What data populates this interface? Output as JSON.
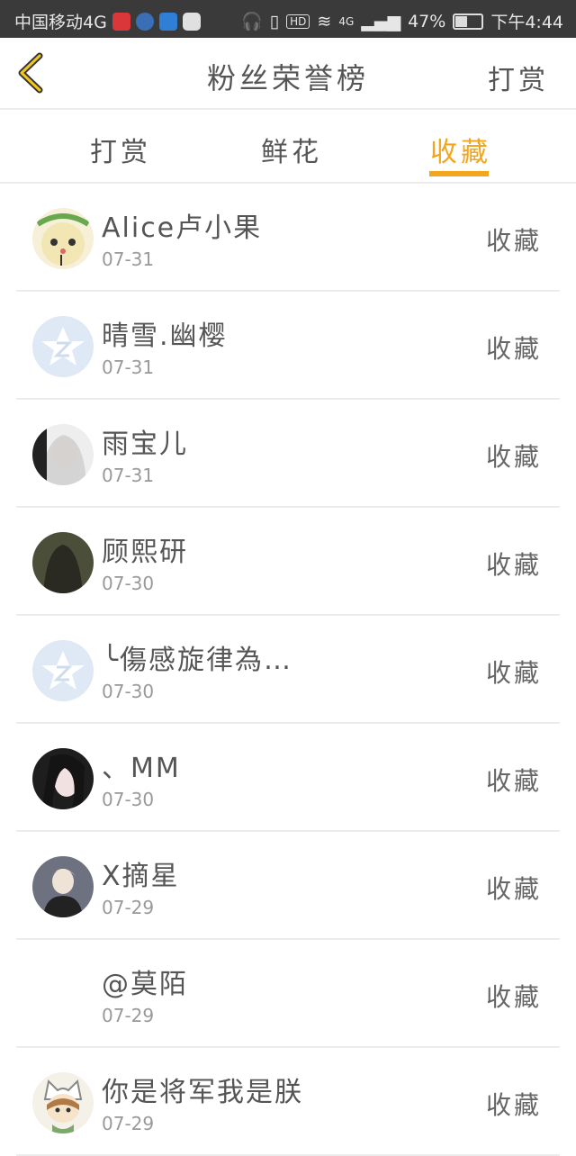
{
  "status_bar": {
    "carrier": "中国移动4G",
    "network": "4G",
    "battery": "47%",
    "time": "下午4:44",
    "icons": [
      "mic-icon",
      "phone-app-icon",
      "shield-icon",
      "app-icon",
      "headphones-icon",
      "vibrate-icon",
      "hd-icon",
      "wifi-icon",
      "signal-icon",
      "battery-icon"
    ],
    "battery_level": 0.47
  },
  "header": {
    "title": "粉丝荣誉榜",
    "action": "打赏",
    "back_icon": "chevron-left-icon"
  },
  "tabs": [
    {
      "label": "打赏"
    },
    {
      "label": "鲜花"
    },
    {
      "label": "收藏",
      "active": true
    }
  ],
  "colors": {
    "accent": "#f3a51b",
    "text": "#555555",
    "subtext": "#999999"
  },
  "list": [
    {
      "name": "Alice卢小果",
      "date": "07-31",
      "action": "收藏",
      "avatar": "cartoon-girl-avatar"
    },
    {
      "name": "晴雪.幽樱",
      "date": "07-31",
      "action": "收藏",
      "avatar": "default-star-avatar"
    },
    {
      "name": "雨宝儿",
      "date": "07-31",
      "action": "收藏",
      "avatar": "photo-avatar"
    },
    {
      "name": "顾熙研",
      "date": "07-30",
      "action": "收藏",
      "avatar": "photo-avatar"
    },
    {
      "name": "╰傷感旋律為…",
      "date": "07-30",
      "action": "收藏",
      "avatar": "default-star-avatar"
    },
    {
      "name": "、MM",
      "date": "07-30",
      "action": "收藏",
      "avatar": "photo-avatar"
    },
    {
      "name": "X摘星",
      "date": "07-29",
      "action": "收藏",
      "avatar": "photo-avatar"
    },
    {
      "name": "@莫陌",
      "date": "07-29",
      "action": "收藏",
      "avatar": "none"
    },
    {
      "name": "你是将军我是朕",
      "date": "07-29",
      "action": "收藏",
      "avatar": "cartoon-cat-hat-avatar"
    }
  ]
}
